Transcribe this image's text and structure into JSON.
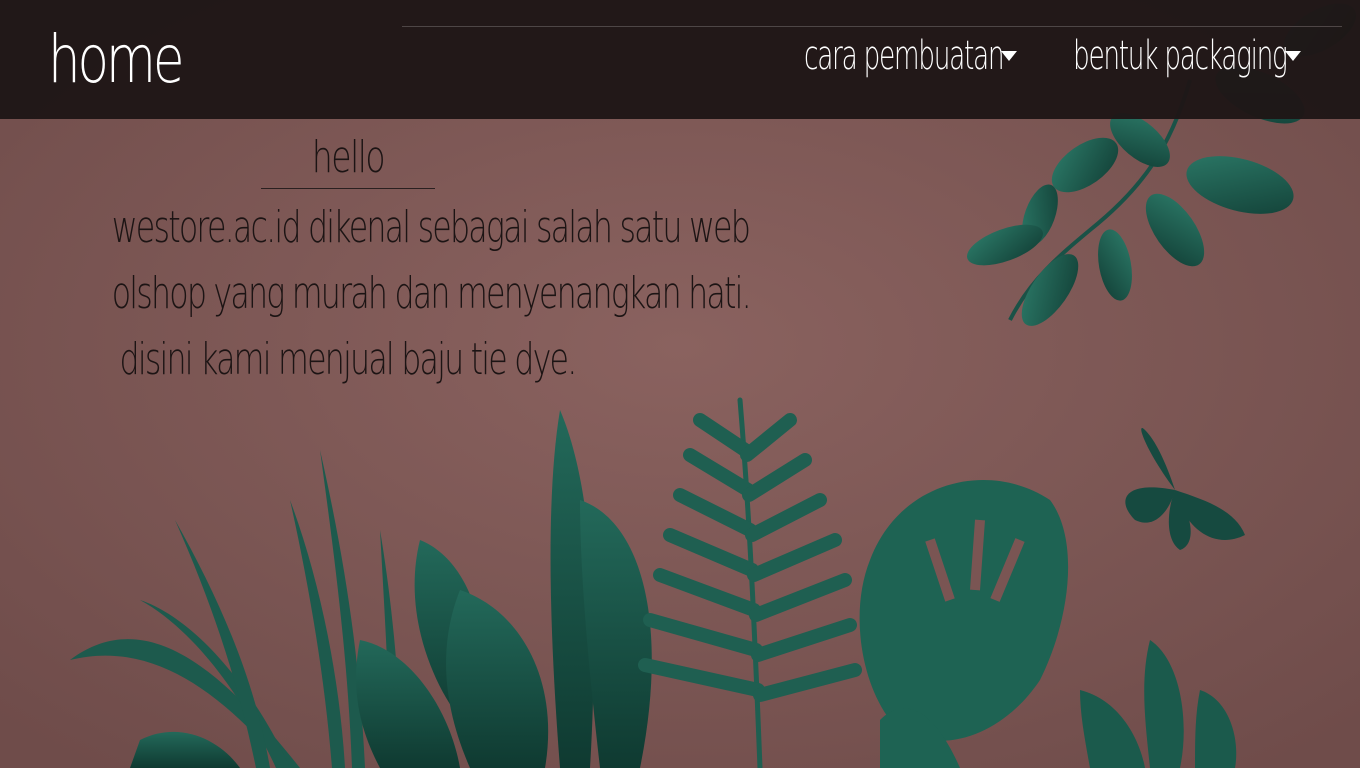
{
  "navbar": {
    "brand": "home",
    "menu": [
      {
        "label": "cara pembuatan",
        "icon": "caret-down-icon"
      },
      {
        "label": "bentuk packaging",
        "icon": "caret-down-icon"
      }
    ]
  },
  "main": {
    "heading": "hello",
    "paragraph_lines": [
      "westore.ac.id dikenal sebagai salah satu web",
      "olshop yang murah dan menyenangkan hati.",
      "disini kami menjual baju tie dye."
    ]
  },
  "colors": {
    "background": "#7a5553",
    "navbar": "#1e1616",
    "foliage": "#1f5b4e",
    "text_dark": "#1c1414",
    "text_light": "#ffffff"
  }
}
